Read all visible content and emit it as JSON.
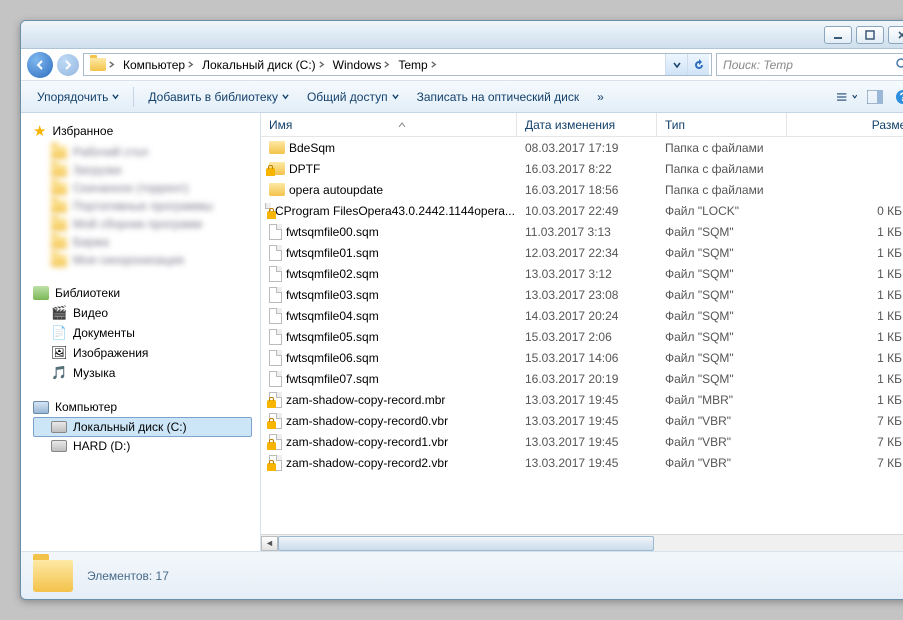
{
  "breadcrumb": [
    "Компьютер",
    "Локальный диск (C:)",
    "Windows",
    "Temp"
  ],
  "search_placeholder": "Поиск: Temp",
  "toolbar": {
    "organize": "Упорядочить",
    "add_library": "Добавить в библиотеку",
    "share": "Общий доступ",
    "burn": "Записать на оптический диск"
  },
  "sidebar": {
    "favorites": "Избранное",
    "fav_items": [
      "Рабочий стол",
      "Загрузки",
      "Скачанное (торрент)",
      "Портативные программы",
      "Мой сборник программ",
      "Биржа",
      "Моя синхронизация"
    ],
    "libraries": "Библиотеки",
    "lib_items": [
      "Видео",
      "Документы",
      "Изображения",
      "Музыка"
    ],
    "computer": "Компьютер",
    "drives": [
      "Локальный диск (C:)",
      "HARD (D:)"
    ]
  },
  "columns": {
    "name": "Имя",
    "date": "Дата изменения",
    "type": "Тип",
    "size": "Размер"
  },
  "files": [
    {
      "icon": "folder",
      "lock": false,
      "name": "BdeSqm",
      "date": "08.03.2017 17:19",
      "type": "Папка с файлами",
      "size": ""
    },
    {
      "icon": "folder",
      "lock": true,
      "name": "DPTF",
      "date": "16.03.2017 8:22",
      "type": "Папка с файлами",
      "size": ""
    },
    {
      "icon": "folder",
      "lock": false,
      "name": "opera autoupdate",
      "date": "16.03.2017 18:56",
      "type": "Папка с файлами",
      "size": ""
    },
    {
      "icon": "file",
      "lock": true,
      "name": "CProgram FilesOpera43.0.2442.1144opera...",
      "date": "10.03.2017 22:49",
      "type": "Файл \"LOCK\"",
      "size": "0 КБ"
    },
    {
      "icon": "file",
      "lock": false,
      "name": "fwtsqmfile00.sqm",
      "date": "11.03.2017 3:13",
      "type": "Файл \"SQM\"",
      "size": "1 КБ"
    },
    {
      "icon": "file",
      "lock": false,
      "name": "fwtsqmfile01.sqm",
      "date": "12.03.2017 22:34",
      "type": "Файл \"SQM\"",
      "size": "1 КБ"
    },
    {
      "icon": "file",
      "lock": false,
      "name": "fwtsqmfile02.sqm",
      "date": "13.03.2017 3:12",
      "type": "Файл \"SQM\"",
      "size": "1 КБ"
    },
    {
      "icon": "file",
      "lock": false,
      "name": "fwtsqmfile03.sqm",
      "date": "13.03.2017 23:08",
      "type": "Файл \"SQM\"",
      "size": "1 КБ"
    },
    {
      "icon": "file",
      "lock": false,
      "name": "fwtsqmfile04.sqm",
      "date": "14.03.2017 20:24",
      "type": "Файл \"SQM\"",
      "size": "1 КБ"
    },
    {
      "icon": "file",
      "lock": false,
      "name": "fwtsqmfile05.sqm",
      "date": "15.03.2017 2:06",
      "type": "Файл \"SQM\"",
      "size": "1 КБ"
    },
    {
      "icon": "file",
      "lock": false,
      "name": "fwtsqmfile06.sqm",
      "date": "15.03.2017 14:06",
      "type": "Файл \"SQM\"",
      "size": "1 КБ"
    },
    {
      "icon": "file",
      "lock": false,
      "name": "fwtsqmfile07.sqm",
      "date": "16.03.2017 20:19",
      "type": "Файл \"SQM\"",
      "size": "1 КБ"
    },
    {
      "icon": "file",
      "lock": true,
      "name": "zam-shadow-copy-record.mbr",
      "date": "13.03.2017 19:45",
      "type": "Файл \"MBR\"",
      "size": "1 КБ"
    },
    {
      "icon": "file",
      "lock": true,
      "name": "zam-shadow-copy-record0.vbr",
      "date": "13.03.2017 19:45",
      "type": "Файл \"VBR\"",
      "size": "7 КБ"
    },
    {
      "icon": "file",
      "lock": true,
      "name": "zam-shadow-copy-record1.vbr",
      "date": "13.03.2017 19:45",
      "type": "Файл \"VBR\"",
      "size": "7 КБ"
    },
    {
      "icon": "file",
      "lock": true,
      "name": "zam-shadow-copy-record2.vbr",
      "date": "13.03.2017 19:45",
      "type": "Файл \"VBR\"",
      "size": "7 КБ"
    }
  ],
  "status": "Элементов: 17"
}
